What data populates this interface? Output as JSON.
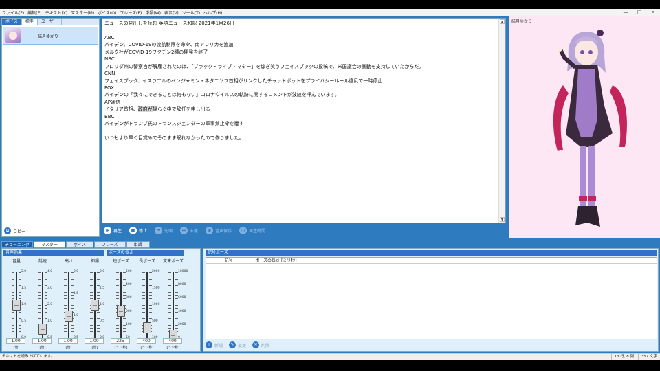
{
  "menu": [
    "ファイル(F)",
    "編集(E)",
    "テキスト(X)",
    "マスター(M)",
    "ボイス(O)",
    "フレーズ(P)",
    "単語(W)",
    "表示(V)",
    "ツール(T)",
    "ヘルプ(H)"
  ],
  "window_buttons": [
    "—",
    "□",
    "✕"
  ],
  "voice_panel": {
    "tab_label": "ボイス",
    "tabs": [
      "標準",
      "ユーザー"
    ],
    "selected_voice": "結月ゆかり",
    "copy_label": "コピー"
  },
  "editor": {
    "lines": [
      "ニュースの見出しを読む 英語ニュース和訳 2021年1月26日",
      "",
      "ABC",
      "バイデン、COVID-19の渡航制限を命令、南アフリカを追加",
      "メルク社がCOVID-19ワクチン2種の開発を終了",
      "NBC",
      "フロリダ州の警察官が解雇されたのは、「ブラック・ライブ・マター」を煽ぎ笑うフェイスブックの投稿で、米国議会の暴動を支持していたからだ。",
      "CNN",
      "フェイスブック、イスラエルのベンジャミン・ネタニヤフ首相がリンクしたチャットボットをプライバシールール違反で一時停止",
      "FOX",
      "バイデンの「我々にできることは何もない」コロナウイルスの軌跡に関するコメントが波紋を呼んでいます。",
      "AP通信",
      "__HL__",
      "BBC",
      "バイデンがトランプ氏のトランスジェンダーの軍事禁止令を覆す",
      "",
      "いつもより早く目覚めてそのまま眠れなかったので作りました。"
    ],
    "highlight_line": {
      "before": "イタリア首相、",
      "highlight": "政府が",
      "after": "揺らぐ中で辞任を申し出る"
    }
  },
  "playback": [
    {
      "icon": "play-icon",
      "glyph": "▶",
      "label": "再生",
      "enabled": true
    },
    {
      "icon": "stop-icon",
      "glyph": "■",
      "label": "停止",
      "enabled": true
    },
    {
      "icon": "skip-back-icon",
      "glyph": "⏮",
      "label": "先頭",
      "enabled": false
    },
    {
      "icon": "skip-forward-icon",
      "glyph": "⏭",
      "label": "末尾",
      "enabled": false
    },
    {
      "icon": "save-audio-icon",
      "glyph": "◉",
      "label": "音声保存",
      "enabled": false
    },
    {
      "icon": "clock-icon",
      "glyph": "◷",
      "label": "再生時間",
      "enabled": false
    }
  ],
  "character": {
    "name": "結月ゆかり",
    "bg_color": "#fde7f4"
  },
  "bottom_tabs": {
    "label": "チューニング",
    "tabs": [
      "マスター",
      "ボイス",
      "フレーズ",
      "単語"
    ],
    "active": 0
  },
  "sliders": {
    "section_voice": "音声効果",
    "section_pause": "ポーズの長さ",
    "items": [
      {
        "label": "音量",
        "value": "1.00",
        "unit": "[倍]",
        "ticks": [
          "2.0",
          "1.5",
          "1.0",
          "0.5",
          "0.0"
        ],
        "fraction": 0.5
      },
      {
        "label": "話速",
        "value": "1.00",
        "unit": "[倍]",
        "ticks": [
          "4.0",
          "3.0",
          "2.0",
          "1.0",
          "0.5"
        ],
        "fraction": 0.14
      },
      {
        "label": "高さ",
        "value": "1.00",
        "unit": "[倍]",
        "ticks": [
          "2.0",
          "1.5",
          "1.0",
          "0.5"
        ],
        "fraction": 0.33
      },
      {
        "label": "抑揚",
        "value": "1.00",
        "unit": "[倍]",
        "ticks": [
          "2.0",
          "1.5",
          "1.0",
          "0.5",
          "0.0"
        ],
        "fraction": 0.5
      },
      {
        "label": "短ポーズ",
        "value": "225",
        "unit": "[ミリ秒]",
        "ticks": [
          "500",
          "400",
          "300",
          "200",
          "100",
          "50"
        ],
        "fraction": 0.41
      },
      {
        "label": "長ポーズ",
        "value": "400",
        "unit": "[ミリ秒]",
        "ticks": [
          "2000",
          "1500",
          "1000",
          "500",
          "100"
        ],
        "fraction": 0.16
      },
      {
        "label": "文末ポーズ",
        "value": "400",
        "unit": "[ミリ秒]",
        "ticks": [
          "10000",
          "8000",
          "6000",
          "4000",
          "2000",
          "0"
        ],
        "fraction": 0.04
      }
    ]
  },
  "symbol_pause": {
    "title": "記号ポーズ",
    "columns": [
      "記号",
      "ポーズの長さ [ミリ秒]"
    ],
    "tools": [
      {
        "icon": "new-icon",
        "glyph": "+",
        "label": "新規"
      },
      {
        "icon": "edit-icon",
        "glyph": "✎",
        "label": "変更"
      },
      {
        "icon": "delete-icon",
        "glyph": "✕",
        "label": "削除"
      }
    ]
  },
  "status": {
    "message": "テキストを読み上げています。",
    "position": "13 行, 8 列",
    "count": "357 文字"
  },
  "colors": {
    "accent": "#2e7bc0",
    "header": "#2f73c9",
    "panel": "#dff0fb"
  }
}
